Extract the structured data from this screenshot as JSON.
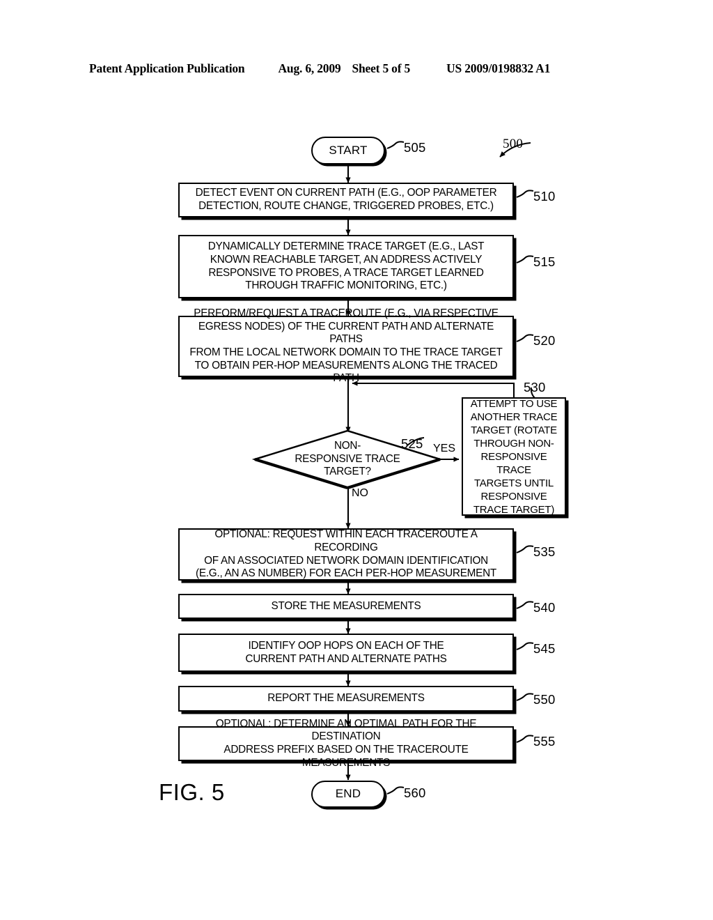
{
  "header": {
    "title": "Patent Application Publication",
    "date": "Aug. 6, 2009",
    "sheet": "Sheet 5 of 5",
    "publication_number": "US 2009/0198832 A1"
  },
  "figure": {
    "caption": "FIG. 5",
    "diagram_ref": "500"
  },
  "chart_data": {
    "type": "diagram",
    "subtype": "flowchart",
    "title": "FIG. 5",
    "diagram_ref": "500",
    "nodes": [
      {
        "id": "505",
        "shape": "terminator",
        "text": "START"
      },
      {
        "id": "510",
        "shape": "process",
        "text": "DETECT EVENT ON CURRENT PATH (E.G., OOP PARAMETER\nDETECTION, ROUTE CHANGE, TRIGGERED PROBES, ETC.)"
      },
      {
        "id": "515",
        "shape": "process",
        "text": "DYNAMICALLY DETERMINE TRACE TARGET (E.G., LAST\nKNOWN REACHABLE TARGET, AN ADDRESS ACTIVELY\nRESPONSIVE TO PROBES, A TRACE TARGET LEARNED\nTHROUGH TRAFFIC MONITORING, ETC.)"
      },
      {
        "id": "520",
        "shape": "process",
        "text": "PERFORM/REQUEST A TRACEROUTE (E.G., VIA RESPECTIVE\nEGRESS NODES) OF THE CURRENT PATH AND ALTERNATE PATHS\nFROM THE LOCAL NETWORK DOMAIN TO THE TRACE TARGET\nTO OBTAIN PER-HOP MEASUREMENTS ALONG THE TRACED PATH"
      },
      {
        "id": "525",
        "shape": "decision",
        "text": "NON-\nRESPONSIVE TRACE\nTARGET?"
      },
      {
        "id": "530",
        "shape": "process",
        "text": "ATTEMPT TO USE\nANOTHER TRACE\nTARGET (ROTATE\nTHROUGH NON-\nRESPONSIVE TRACE\nTARGETS UNTIL\nRESPONSIVE\nTRACE TARGET)"
      },
      {
        "id": "535",
        "shape": "process",
        "text": "OPTIONAL: REQUEST WITHIN EACH TRACEROUTE A RECORDING\nOF AN ASSOCIATED NETWORK DOMAIN IDENTIFICATION\n(E.G., AN AS NUMBER) FOR EACH PER-HOP MEASUREMENT"
      },
      {
        "id": "540",
        "shape": "process",
        "text": "STORE THE MEASUREMENTS"
      },
      {
        "id": "545",
        "shape": "process",
        "text": "IDENTIFY OOP HOPS ON EACH OF THE\nCURRENT PATH AND ALTERNATE PATHS"
      },
      {
        "id": "550",
        "shape": "process",
        "text": "REPORT THE MEASUREMENTS"
      },
      {
        "id": "555",
        "shape": "process",
        "text": "OPTIONAL: DETERMINE AN OPTIMAL PATH FOR THE DESTINATION\nADDRESS PREFIX BASED ON THE TRACEROUTE MEASUREMENTS"
      },
      {
        "id": "560",
        "shape": "terminator",
        "text": "END"
      }
    ],
    "edges": [
      {
        "from": "505",
        "to": "510",
        "label": ""
      },
      {
        "from": "510",
        "to": "515",
        "label": ""
      },
      {
        "from": "515",
        "to": "520",
        "label": ""
      },
      {
        "from": "520",
        "to": "525",
        "label": ""
      },
      {
        "from": "525",
        "to": "530",
        "label": "YES"
      },
      {
        "from": "525",
        "to": "535",
        "label": "NO"
      },
      {
        "from": "530",
        "to": "525",
        "label": ""
      },
      {
        "from": "535",
        "to": "540",
        "label": ""
      },
      {
        "from": "540",
        "to": "545",
        "label": ""
      },
      {
        "from": "545",
        "to": "550",
        "label": ""
      },
      {
        "from": "550",
        "to": "555",
        "label": ""
      },
      {
        "from": "555",
        "to": "560",
        "label": ""
      }
    ],
    "branch_labels": {
      "yes": "YES",
      "no": "NO"
    }
  }
}
